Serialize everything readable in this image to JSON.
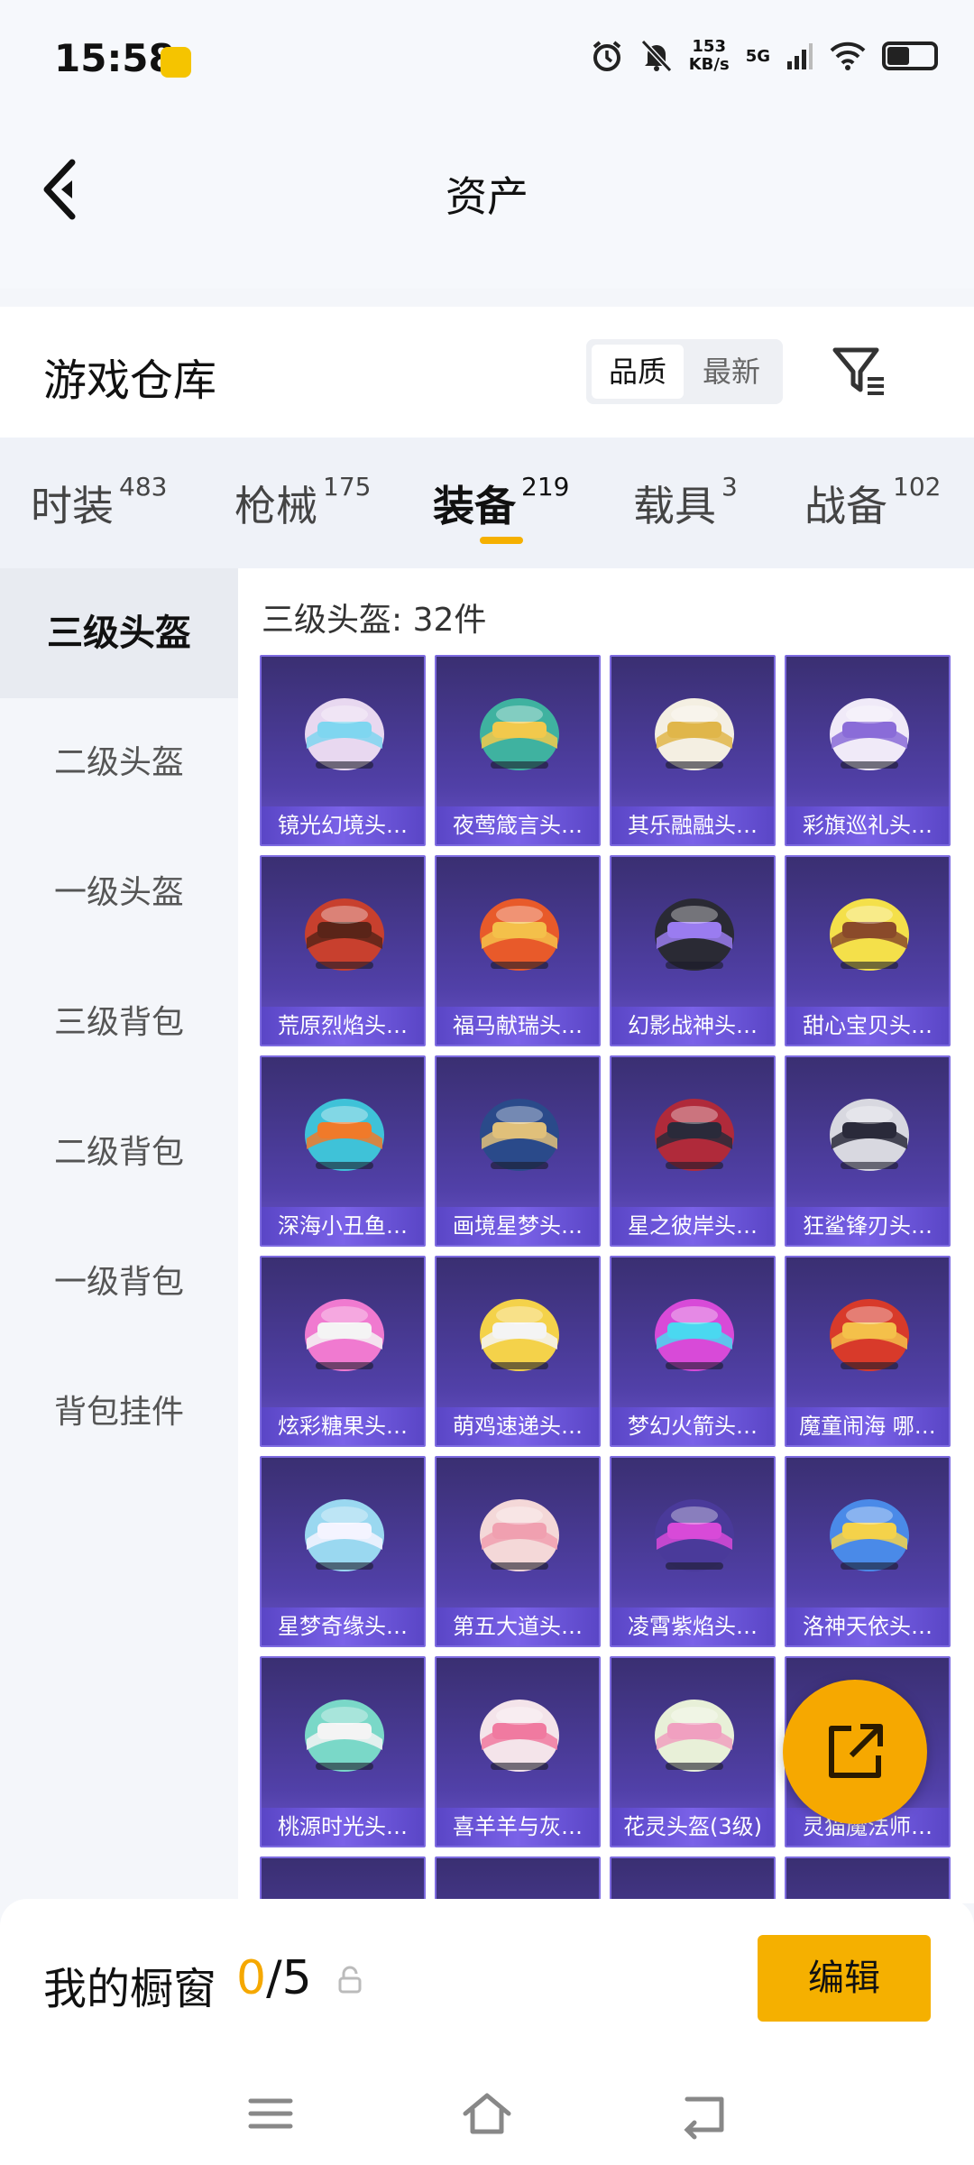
{
  "status": {
    "time": "15:58",
    "speed": "153",
    "speed_unit": "KB/s",
    "network": "5G"
  },
  "header": {
    "title": "资产"
  },
  "warehouse": {
    "title": "游戏仓库",
    "sort_quality": "品质",
    "sort_newest": "最新"
  },
  "tabs": [
    {
      "label": "时装",
      "count": "483"
    },
    {
      "label": "枪械",
      "count": "175"
    },
    {
      "label": "装备",
      "count": "219"
    },
    {
      "label": "载具",
      "count": "3"
    },
    {
      "label": "战备",
      "count": "102"
    }
  ],
  "sidebar": {
    "items": [
      {
        "label": "三级头盔"
      },
      {
        "label": "二级头盔"
      },
      {
        "label": "一级头盔"
      },
      {
        "label": "三级背包"
      },
      {
        "label": "二级背包"
      },
      {
        "label": "一级背包"
      },
      {
        "label": "背包挂件"
      }
    ]
  },
  "content": {
    "count_label": "三级头盔: 32件",
    "items": [
      {
        "name": "镜光幻境头…",
        "color": "#e8d8f0",
        "accent": "#7fd6f0"
      },
      {
        "name": "夜莺箴言头…",
        "color": "#3fb2a0",
        "accent": "#f2c94c"
      },
      {
        "name": "其乐融融头…",
        "color": "#f4efe2",
        "accent": "#e0b64a"
      },
      {
        "name": "彩旗巡礼头…",
        "color": "#f0eaf8",
        "accent": "#8a6cd8"
      },
      {
        "name": "荒原烈焰头…",
        "color": "#c8402e",
        "accent": "#5a2418"
      },
      {
        "name": "福马献瑞头…",
        "color": "#e85a2a",
        "accent": "#f4c04a"
      },
      {
        "name": "幻影战神头…",
        "color": "#2a2a34",
        "accent": "#9a7cf0"
      },
      {
        "name": "甜心宝贝头…",
        "color": "#f4e04a",
        "accent": "#8a4a2a"
      },
      {
        "name": "深海小丑鱼…",
        "color": "#3fc2d8",
        "accent": "#f07a2a"
      },
      {
        "name": "画境星梦头…",
        "color": "#2a4a8a",
        "accent": "#e0c07a"
      },
      {
        "name": "星之彼岸头…",
        "color": "#b02a3a",
        "accent": "#2a2a3a"
      },
      {
        "name": "狂鲨锋刃头…",
        "color": "#d8d8e0",
        "accent": "#2a2a3a"
      },
      {
        "name": "炫彩糖果头…",
        "color": "#f07ad0",
        "accent": "#f4f4f4"
      },
      {
        "name": "萌鸡速递头…",
        "color": "#f4d24a",
        "accent": "#f4f4f4"
      },
      {
        "name": "梦幻火箭头…",
        "color": "#d84ad8",
        "accent": "#4ad8f0"
      },
      {
        "name": "魔童闹海 哪…",
        "color": "#d83a2a",
        "accent": "#f4c04a"
      },
      {
        "name": "星梦奇缘头…",
        "color": "#9ad8f0",
        "accent": "#f4f4ff"
      },
      {
        "name": "第五大道头…",
        "color": "#f4d8d8",
        "accent": "#f0a0b0"
      },
      {
        "name": "凌霄紫焰头…",
        "color": "#4a3a9a",
        "accent": "#d84ad8"
      },
      {
        "name": "洛神天依头…",
        "color": "#4a8ae8",
        "accent": "#f4d24a"
      },
      {
        "name": "桃源时光头…",
        "color": "#7ad8c8",
        "accent": "#f4f4f4"
      },
      {
        "name": "喜羊羊与灰…",
        "color": "#f4e4ea",
        "accent": "#f07aa0"
      },
      {
        "name": "花灵头盔(3级)",
        "color": "#e8f0d8",
        "accent": "#f0a0c0"
      },
      {
        "name": "灵猫魔法师…",
        "color": "#3a3a7a",
        "accent": "#f4d24a"
      },
      {
        "name": "",
        "color": "#f07ad0",
        "accent": "#f4f4f4"
      },
      {
        "name": "",
        "color": "#f4f4f4",
        "accent": "#d8d8e0"
      },
      {
        "name": "",
        "color": "#e8e8f0",
        "accent": "#c8c8d8"
      },
      {
        "name": "",
        "color": "#f4d24a",
        "accent": "#f4f4f4"
      }
    ]
  },
  "showcase": {
    "title": "我的橱窗",
    "used": "0",
    "total": "/5",
    "edit_label": "编辑"
  },
  "icons": {
    "back": "chevron-left-icon",
    "filter": "filter-icon",
    "share": "share-external-icon",
    "lock": "lock-icon",
    "nav_menu": "menu-icon",
    "nav_home": "home-icon",
    "nav_back": "back-icon"
  }
}
